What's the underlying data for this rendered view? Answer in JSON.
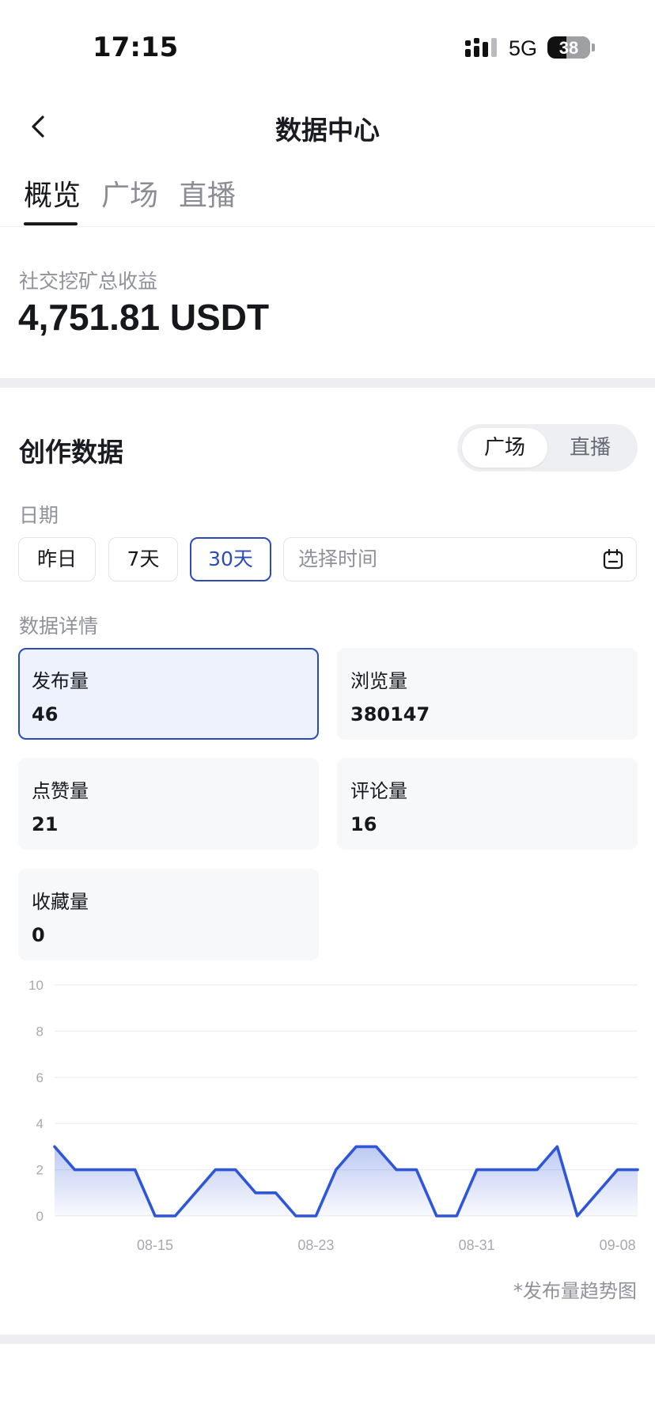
{
  "status_bar": {
    "time": "17:15",
    "network": "5G",
    "battery": "38"
  },
  "header": {
    "title": "数据中心"
  },
  "tabs": [
    {
      "label": "概览",
      "active": true
    },
    {
      "label": "广场",
      "active": false
    },
    {
      "label": "直播",
      "active": false
    }
  ],
  "earnings": {
    "label": "社交挖矿总收益",
    "value": "4,751.81 USDT"
  },
  "creation": {
    "title": "创作数据",
    "segments": [
      {
        "label": "广场",
        "active": true
      },
      {
        "label": "直播",
        "active": false
      }
    ],
    "date_label": "日期",
    "date_options": [
      {
        "label": "昨日",
        "active": false
      },
      {
        "label": "7天",
        "active": false
      },
      {
        "label": "30天",
        "active": true
      }
    ],
    "date_picker_placeholder": "选择时间",
    "details_label": "数据详情",
    "metrics": [
      {
        "label": "发布量",
        "value": "46",
        "active": true
      },
      {
        "label": "浏览量",
        "value": "380147",
        "active": false
      },
      {
        "label": "点赞量",
        "value": "21",
        "active": false
      },
      {
        "label": "评论量",
        "value": "16",
        "active": false
      },
      {
        "label": "收藏量",
        "value": "0",
        "active": false
      }
    ],
    "footnote": "*发布量趋势图"
  },
  "colors": {
    "accent": "#2b4bbb",
    "line": "#2f56d8",
    "text": "#17181c",
    "muted": "#8f9299"
  },
  "chart_data": {
    "type": "area",
    "y_ticks": [
      0,
      2,
      4,
      6,
      8,
      10
    ],
    "ylim": [
      0,
      10
    ],
    "x_ticks": [
      "08-15",
      "08-23",
      "08-31",
      "09-08"
    ],
    "x_tick_indices": [
      5,
      13,
      21,
      28
    ],
    "values": [
      3,
      2,
      2,
      2,
      2,
      0,
      0,
      1,
      2,
      2,
      1,
      1,
      0,
      0,
      2,
      3,
      3,
      2,
      2,
      0,
      0,
      2,
      2,
      2,
      2,
      3,
      0,
      1,
      2,
      2
    ],
    "grid": true
  }
}
